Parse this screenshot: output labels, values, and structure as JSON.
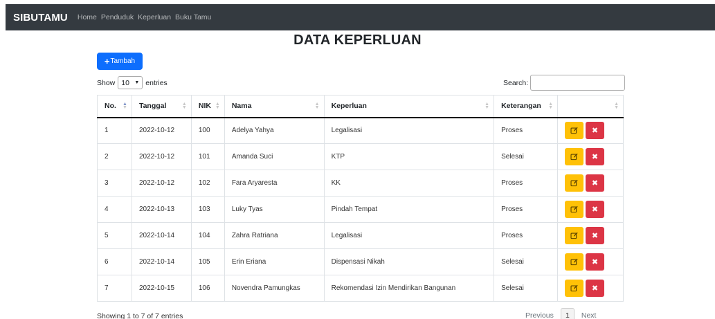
{
  "navbar": {
    "brand": "SIBUTAMU",
    "links": [
      "Home",
      "Penduduk",
      "Keperluan",
      "Buku Tamu"
    ]
  },
  "page": {
    "title": "DATA KEPERLUAN",
    "add_button": "Tambah"
  },
  "controls": {
    "show_label": "Show",
    "entries_value": "10",
    "entries_label": "entries",
    "search_label": "Search:"
  },
  "table": {
    "headers": [
      "No.",
      "Tanggal",
      "NIK",
      "Nama",
      "Keperluan",
      "Keterangan",
      ""
    ],
    "rows": [
      [
        "1",
        "2022-10-12",
        "100",
        "Adelya Yahya",
        "Legalisasi",
        "Proses"
      ],
      [
        "2",
        "2022-10-12",
        "101",
        "Amanda Suci",
        "KTP",
        "Selesai"
      ],
      [
        "3",
        "2022-10-12",
        "102",
        "Fara Aryaresta",
        "KK",
        "Proses"
      ],
      [
        "4",
        "2022-10-13",
        "103",
        "Luky Tyas",
        "Pindah Tempat",
        "Proses"
      ],
      [
        "5",
        "2022-10-14",
        "104",
        "Zahra Ratriana",
        "Legalisasi",
        "Proses"
      ],
      [
        "6",
        "2022-10-14",
        "105",
        "Erin Eriana",
        "Dispensasi Nikah",
        "Selesai"
      ],
      [
        "7",
        "2022-10-15",
        "106",
        "Novendra Pamungkas",
        "Rekomendasi Izin Mendirikan Bangunan",
        "Selesai"
      ]
    ]
  },
  "footer": {
    "info": "Showing 1 to 7 of 7 entries",
    "previous": "Previous",
    "current_page": "1",
    "next": "Next"
  },
  "icons": {
    "edit": "edit-icon",
    "delete": "close-icon",
    "sort": "sort-icon"
  },
  "colors": {
    "navbar": "#343a40",
    "primary": "#0d6efd",
    "warning": "#ffc107",
    "danger": "#dc3545"
  }
}
